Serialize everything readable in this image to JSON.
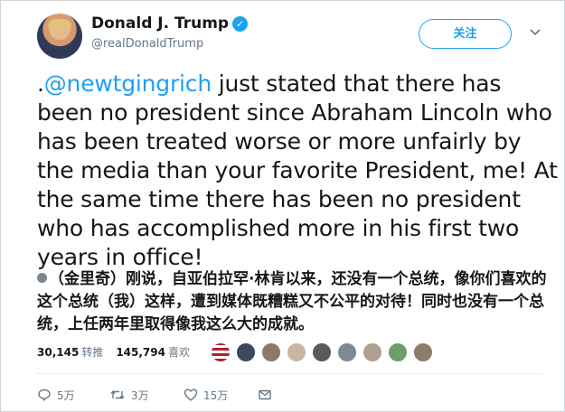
{
  "header": {
    "display_name": "Donald J. Trump",
    "handle": "@realDonaldTrump",
    "follow_label": "关注",
    "verified_glyph": "✓"
  },
  "tweet": {
    "prefix": ".",
    "mention": "@newtgingrich",
    "body": " just stated that there has been no president since Abraham Lincoln who has been treated worse or more unfairly by the media than your favorite President, me! At the same time there has been no president who has accomplished more in his first two years in office!"
  },
  "translation": {
    "text": "（金里奇）刚说，自亚伯拉罕·林肯以来，还没有一个总统，像你们喜欢的这个总统（我）这样，遭到媒体既糟糕又不公平的对待！同时也没有一个总统，上任两年里取得像我这么大的成就。"
  },
  "stats": {
    "retweets_count": "30,145",
    "retweets_label": "转推",
    "likes_count": "145,794",
    "likes_label": "喜欢"
  },
  "actions": {
    "reply_count": "5万",
    "retweet_count": "3万",
    "like_count": "15万"
  },
  "icons": [
    "verified-badge-icon",
    "chevron-down-icon",
    "reply-icon",
    "retweet-icon",
    "like-icon",
    "message-icon"
  ],
  "colors": {
    "accent": "#1da1f2",
    "text": "#14171a",
    "muted": "#657786"
  }
}
